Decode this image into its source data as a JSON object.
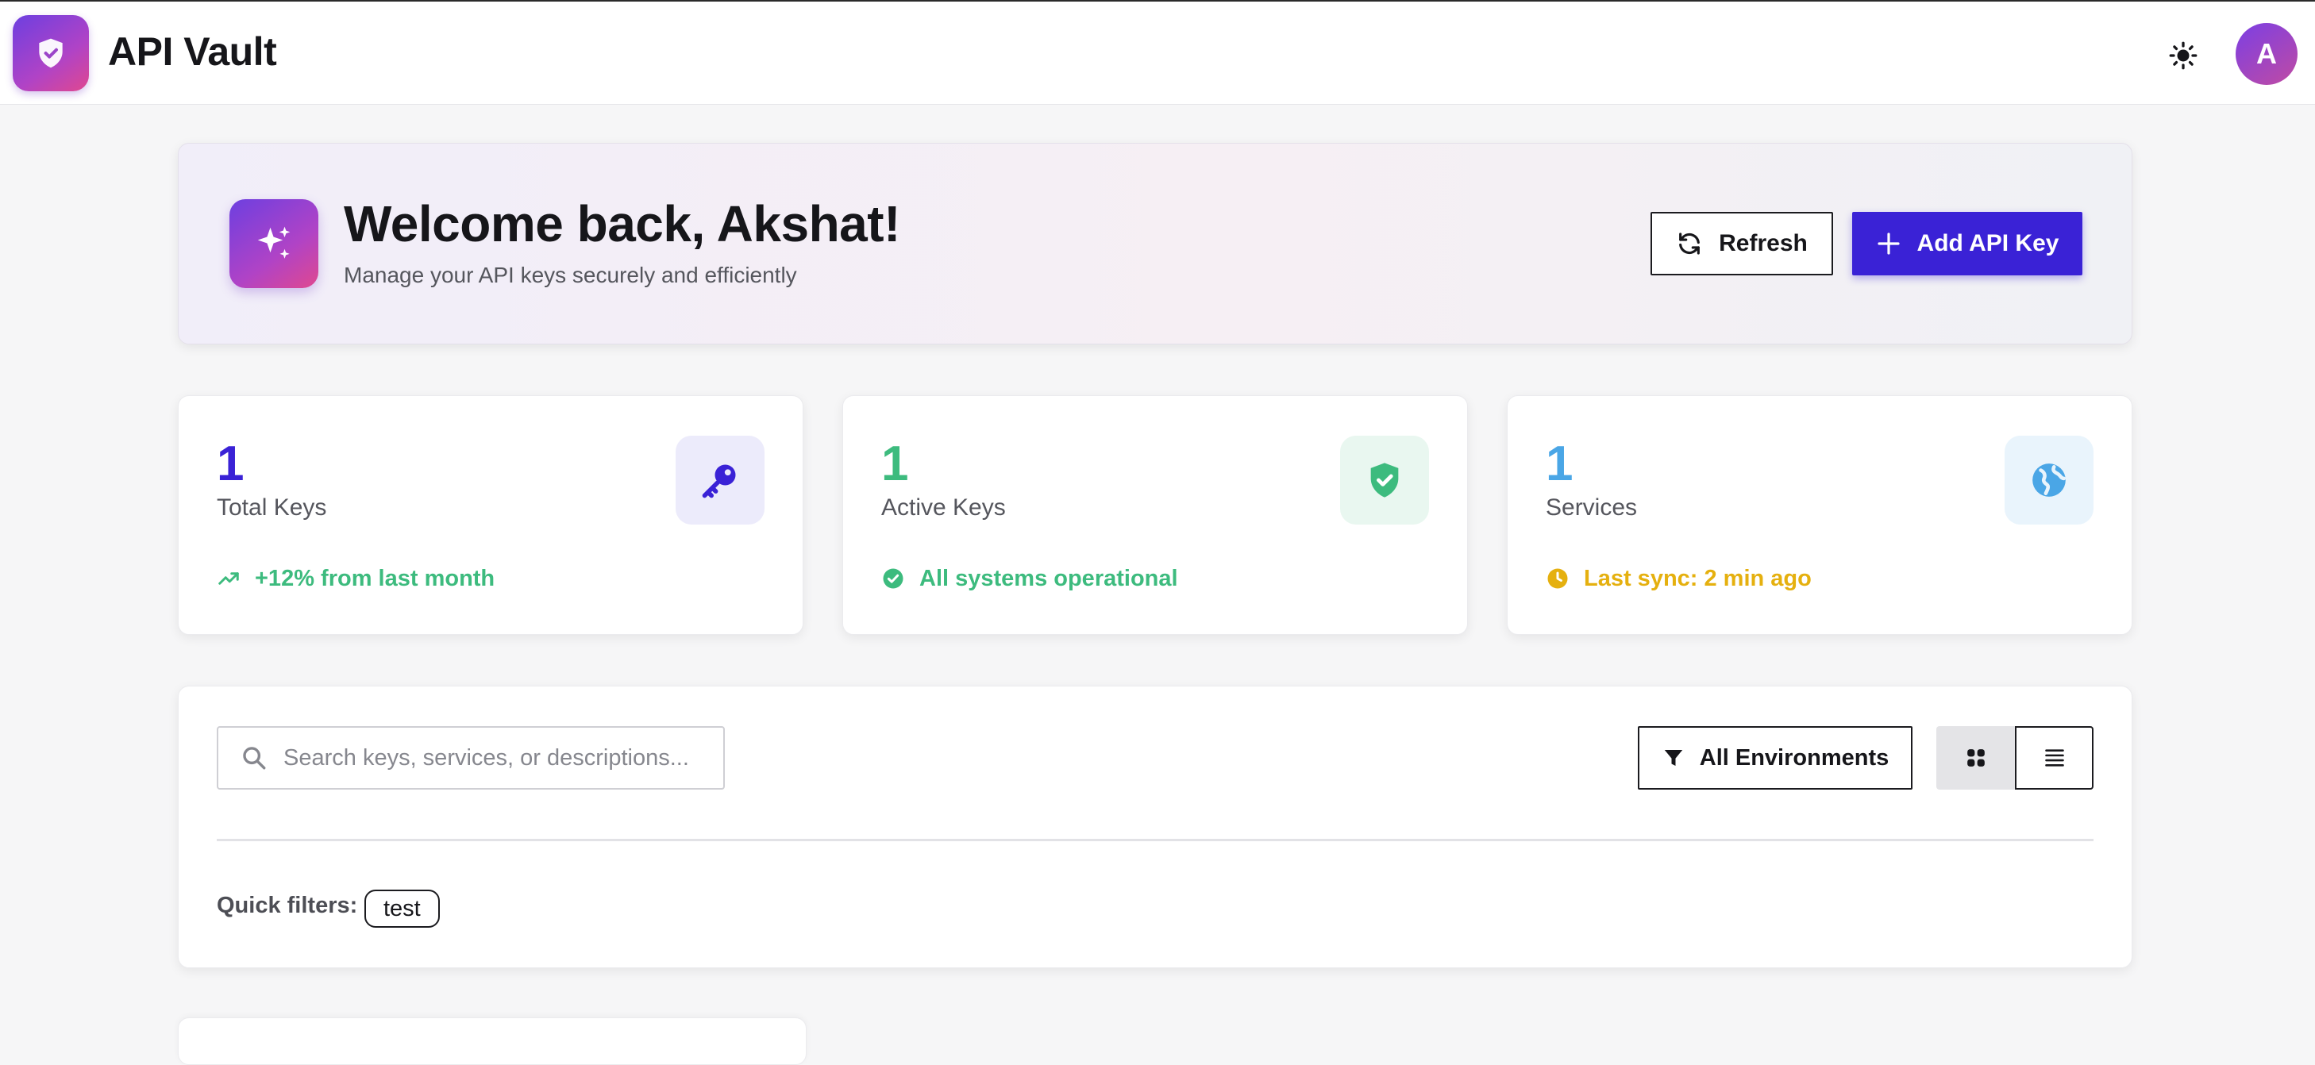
{
  "header": {
    "app_title": "API Vault",
    "logo_icon": "shield-check-icon",
    "theme_icon": "sun-icon",
    "avatar_initial": "A"
  },
  "welcome": {
    "icon": "sparkles-icon",
    "title": "Welcome back, Akshat!",
    "subtitle": "Manage your API keys securely and efficiently",
    "refresh_label": "Refresh",
    "add_label": "Add API Key"
  },
  "stats": [
    {
      "value": "1",
      "label": "Total Keys",
      "icon": "key-icon",
      "foot_icon": "trending-up-icon",
      "foot_text": "+12% from last month",
      "value_color": "#3a22d6",
      "foot_color": "#3dbb7e"
    },
    {
      "value": "1",
      "label": "Active Keys",
      "icon": "shield-check-icon",
      "foot_icon": "check-circle-icon",
      "foot_text": "All systems operational",
      "value_color": "#3dbb7e",
      "foot_color": "#3dbb7e"
    },
    {
      "value": "1",
      "label": "Services",
      "icon": "globe-icon",
      "foot_icon": "clock-icon",
      "foot_text": "Last sync: 2 min ago",
      "value_color": "#4aa6e6",
      "foot_color": "#e5b00f"
    }
  ],
  "filters": {
    "search_placeholder": "Search keys, services, or descriptions...",
    "search_value": "",
    "environment_label": "All Environments",
    "quick_filters_label": "Quick filters:",
    "quick_filters": [
      "test"
    ],
    "view_mode": "grid"
  },
  "colors": {
    "primary": "#3a22d6",
    "gradient_start": "#6d3fe0",
    "gradient_end": "#e0488f",
    "success": "#3dbb7e",
    "info": "#4aa6e6",
    "warning": "#e5b00f"
  }
}
